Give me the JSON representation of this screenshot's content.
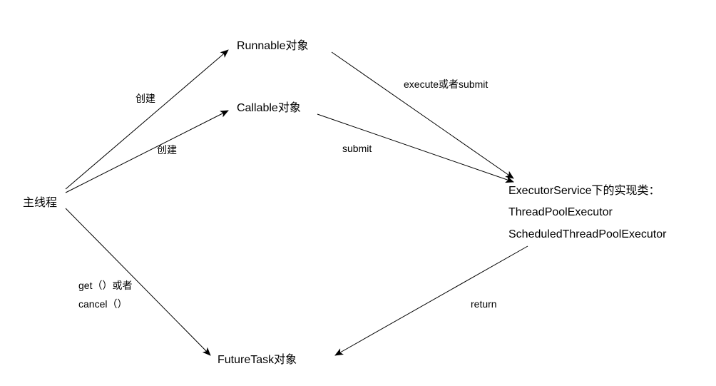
{
  "nodes": {
    "main_thread": "主线程",
    "runnable": "Runnable对象",
    "callable": "Callable对象",
    "executor_line1": "ExecutorService下的实现类：",
    "executor_line2": "ThreadPoolExecutor",
    "executor_line3": "ScheduledThreadPoolExecutor",
    "futuretask": "FutureTask对象"
  },
  "edges": {
    "create1": "创建",
    "create2": "创建",
    "execute_or_submit": "execute或者submit",
    "submit": "submit",
    "get_or": "get（）或者",
    "cancel": "cancel（）",
    "return": "return"
  }
}
